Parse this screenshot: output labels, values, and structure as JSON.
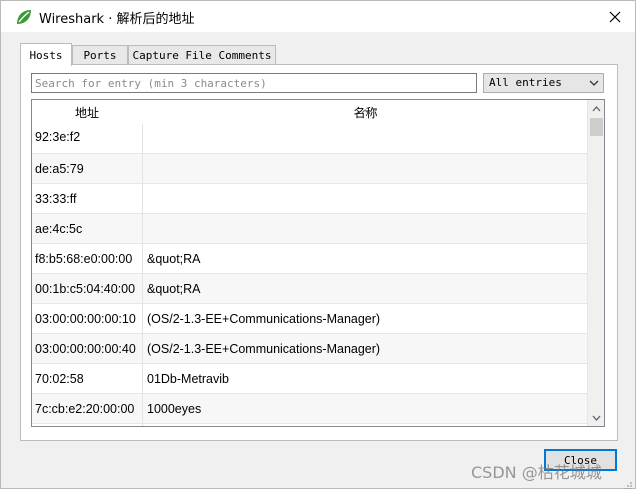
{
  "window": {
    "title": "Wireshark · 解析后的地址",
    "close_glyph": "✕"
  },
  "tabs": [
    {
      "label": "Hosts",
      "active": true
    },
    {
      "label": "Ports",
      "active": false
    },
    {
      "label": "Capture File Comments",
      "active": false
    }
  ],
  "search": {
    "placeholder": "Search for entry (min 3 characters)",
    "value": ""
  },
  "filter": {
    "selected": "All entries"
  },
  "table": {
    "columns": [
      "地址",
      "名称"
    ],
    "rows": [
      {
        "address": "92:3e:f2",
        "name": ""
      },
      {
        "address": "de:a5:79",
        "name": ""
      },
      {
        "address": "33:33:ff",
        "name": ""
      },
      {
        "address": "ae:4c:5c",
        "name": ""
      },
      {
        "address": "f8:b5:68:e0:00:00",
        "name": "&quot;RA"
      },
      {
        "address": "00:1b:c5:04:40:00",
        "name": "&quot;RA"
      },
      {
        "address": "03:00:00:00:00:10",
        "name": "(OS/2-1.3-EE+Communications-Manager)"
      },
      {
        "address": "03:00:00:00:00:40",
        "name": "(OS/2-1.3-EE+Communications-Manager)"
      },
      {
        "address": "70:02:58",
        "name": "01Db-Metravib"
      },
      {
        "address": "7c:cb:e2:20:00:00",
        "name": "1000eyes"
      }
    ]
  },
  "buttons": {
    "close_label": "Close"
  },
  "watermark": {
    "text": "CSDN @枯花城城"
  },
  "colors": {
    "accent": "#0078d7",
    "brand_icon": "#3a9a3a"
  }
}
